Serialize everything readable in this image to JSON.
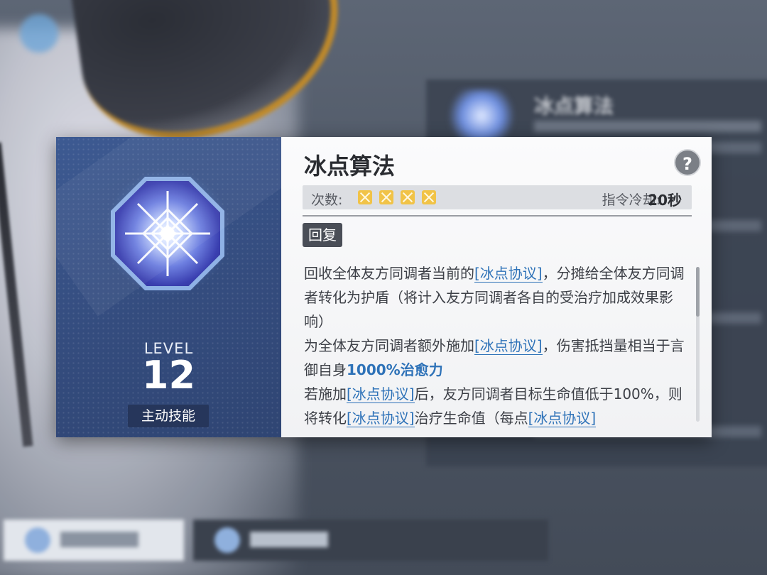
{
  "background": {
    "panel_title": "冰点算法"
  },
  "skill": {
    "name": "冰点算法",
    "level_label": "LEVEL",
    "level": "12",
    "type": "主动技能",
    "help_icon": "?",
    "uses_label": "次数:",
    "uses_remaining": 4,
    "uses_icon": "crossed-swords-icon",
    "cooldown_label": "指令冷却:",
    "cooldown_value": "20秒",
    "tag": "回复",
    "description": {
      "p1_a": "回收全体友方同调者当前的",
      "p1_kw": "[冰点协议]",
      "p1_b": "，分摊给全体友方同调者转化为护盾（将计入友方同调者各自的受治疗加成效果影响）",
      "p2_a": "为全体友方同调者额外施加",
      "p2_kw": "[冰点协议]",
      "p2_b": "，伤害抵挡量相当于言御自身",
      "p2_hl": "1000%治愈力",
      "p3_a": "若施加",
      "p3_kw1": "[冰点协议]",
      "p3_b": "后，友方同调者目标生命值低于100%，则将转化",
      "p3_kw2": "[冰点协议]",
      "p3_c": "治疗生命值（每点",
      "p3_kw3": "[冰点协议]"
    }
  },
  "colors": {
    "left_panel": "#344c7e",
    "keyword": "#2e72b8",
    "uses_icon": "#f1c347",
    "type_badge": "#26365b"
  }
}
